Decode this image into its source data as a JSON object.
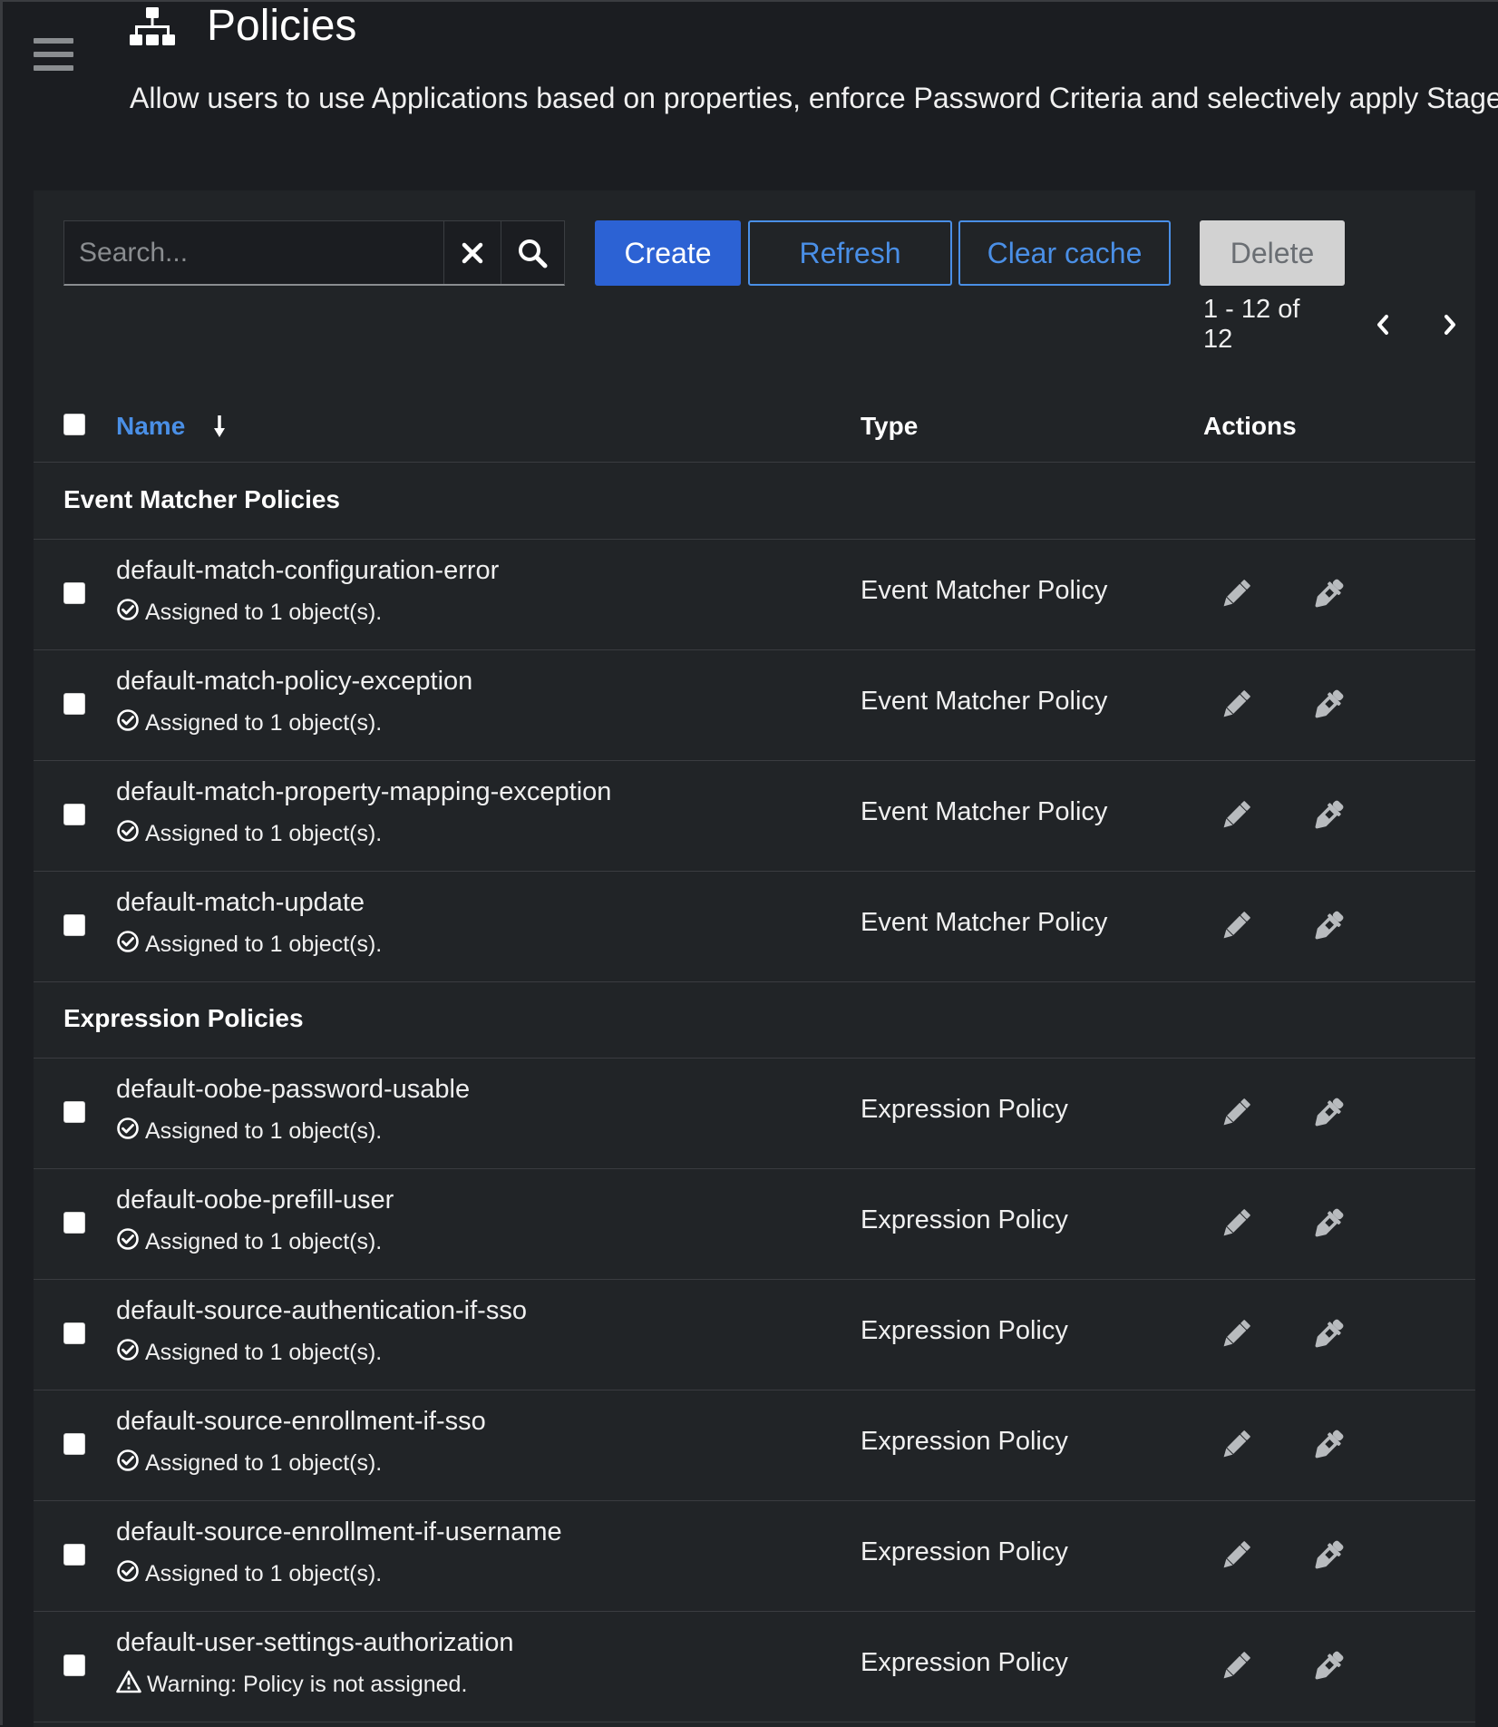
{
  "header": {
    "title": "Policies",
    "description": "Allow users to use Applications based on properties, enforce Password Criteria and selectively apply Stages"
  },
  "toolbar": {
    "search_placeholder": "Search...",
    "create_label": "Create",
    "refresh_label": "Refresh",
    "clear_cache_label": "Clear cache",
    "delete_label": "Delete",
    "pagination": "1 - 12 of 12"
  },
  "table": {
    "columns": {
      "name": "Name",
      "type": "Type",
      "actions": "Actions"
    },
    "groups": [
      {
        "label": "Event Matcher Policies",
        "rows": [
          {
            "name": "default-match-configuration-error",
            "status": "Assigned to 1 object(s).",
            "assigned": true,
            "type": "Event Matcher Policy"
          },
          {
            "name": "default-match-policy-exception",
            "status": "Assigned to 1 object(s).",
            "assigned": true,
            "type": "Event Matcher Policy"
          },
          {
            "name": "default-match-property-mapping-exception",
            "status": "Assigned to 1 object(s).",
            "assigned": true,
            "type": "Event Matcher Policy"
          },
          {
            "name": "default-match-update",
            "status": "Assigned to 1 object(s).",
            "assigned": true,
            "type": "Event Matcher Policy"
          }
        ]
      },
      {
        "label": "Expression Policies",
        "rows": [
          {
            "name": "default-oobe-password-usable",
            "status": "Assigned to 1 object(s).",
            "assigned": true,
            "type": "Expression Policy"
          },
          {
            "name": "default-oobe-prefill-user",
            "status": "Assigned to 1 object(s).",
            "assigned": true,
            "type": "Expression Policy"
          },
          {
            "name": "default-source-authentication-if-sso",
            "status": "Assigned to 1 object(s).",
            "assigned": true,
            "type": "Expression Policy"
          },
          {
            "name": "default-source-enrollment-if-sso",
            "status": "Assigned to 1 object(s).",
            "assigned": true,
            "type": "Expression Policy"
          },
          {
            "name": "default-source-enrollment-if-username",
            "status": "Assigned to 1 object(s).",
            "assigned": true,
            "type": "Expression Policy"
          },
          {
            "name": "default-user-settings-authorization",
            "status": "Warning: Policy is not assigned.",
            "assigned": false,
            "type": "Expression Policy"
          }
        ]
      }
    ]
  },
  "icons": {
    "menu": "hamburger-menu-icon",
    "title": "sitemap-icon",
    "clear": "times-icon",
    "search": "search-icon",
    "prev": "angle-left-icon",
    "next": "angle-right-icon",
    "sort": "long-arrow-down-icon",
    "assigned": "check-circle-icon",
    "unassigned": "warning-triangle-icon",
    "edit": "pencil-icon",
    "test": "eyedropper-icon"
  },
  "colors": {
    "background": "#1b1d21",
    "card": "#212427",
    "primary": "#2c62d4",
    "link": "#4a8fe6",
    "disabled": "#d2d2d2"
  }
}
